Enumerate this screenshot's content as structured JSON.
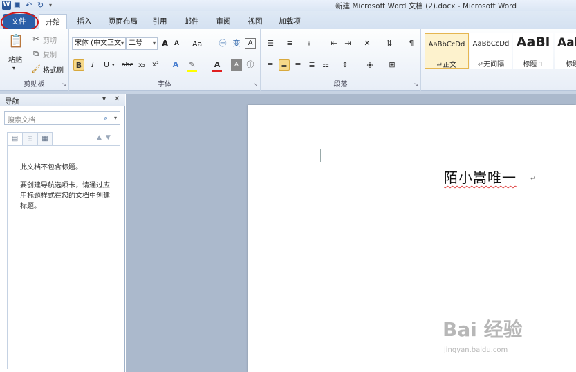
{
  "window": {
    "title": "新建 Microsoft Word 文档 (2).docx - Microsoft Word",
    "quick_access": [
      "word-logo-icon",
      "save-icon",
      "undo-icon",
      "redo-icon",
      "customize-icon"
    ],
    "app_logo": "W"
  },
  "tabs": {
    "file": "文件",
    "home": "开始",
    "insert": "插入",
    "layout": "页面布局",
    "references": "引用",
    "mailings": "邮件",
    "review": "审阅",
    "view": "视图",
    "addins": "加载项"
  },
  "clipboard": {
    "paste": "粘贴",
    "cut": "剪切",
    "copy": "复制",
    "format_painter": "格式刷",
    "label": "剪贴板"
  },
  "font": {
    "font_name": "宋体 (中文正文",
    "font_size": "二号",
    "grow": "A",
    "shrink": "A",
    "change_case": "Aa",
    "bold": "B",
    "italic": "I",
    "underline": "U",
    "strikethrough": "abe",
    "subscript": "x₂",
    "superscript": "x²",
    "label": "字体"
  },
  "paragraph": {
    "label": "段落"
  },
  "styles": {
    "items": [
      {
        "sample": "AaBbCcDd",
        "name": "↵正文"
      },
      {
        "sample": "AaBbCcDd",
        "name": "↵无间隔"
      },
      {
        "sample": "AaBl",
        "name": "标题 1"
      },
      {
        "sample": "Aal",
        "name": "标题"
      }
    ]
  },
  "nav_pane": {
    "title": "导航",
    "search_placeholder": "搜索文档",
    "message1": "此文档不包含标题。",
    "message2": "要创建导航选项卡，请通过应用标题样式在您的文档中创建标题。"
  },
  "document": {
    "text": "陌小嵩唯一",
    "paragraph_mark": "↵"
  },
  "watermark": {
    "main": "Bai 经验",
    "sub": "jingyan.baidu.com"
  },
  "colors": {
    "file_tab": "#2a5ea8",
    "highlight_circle": "#d11a1a",
    "selected_button": "#f6d889",
    "doc_background": "#abb9cc"
  }
}
